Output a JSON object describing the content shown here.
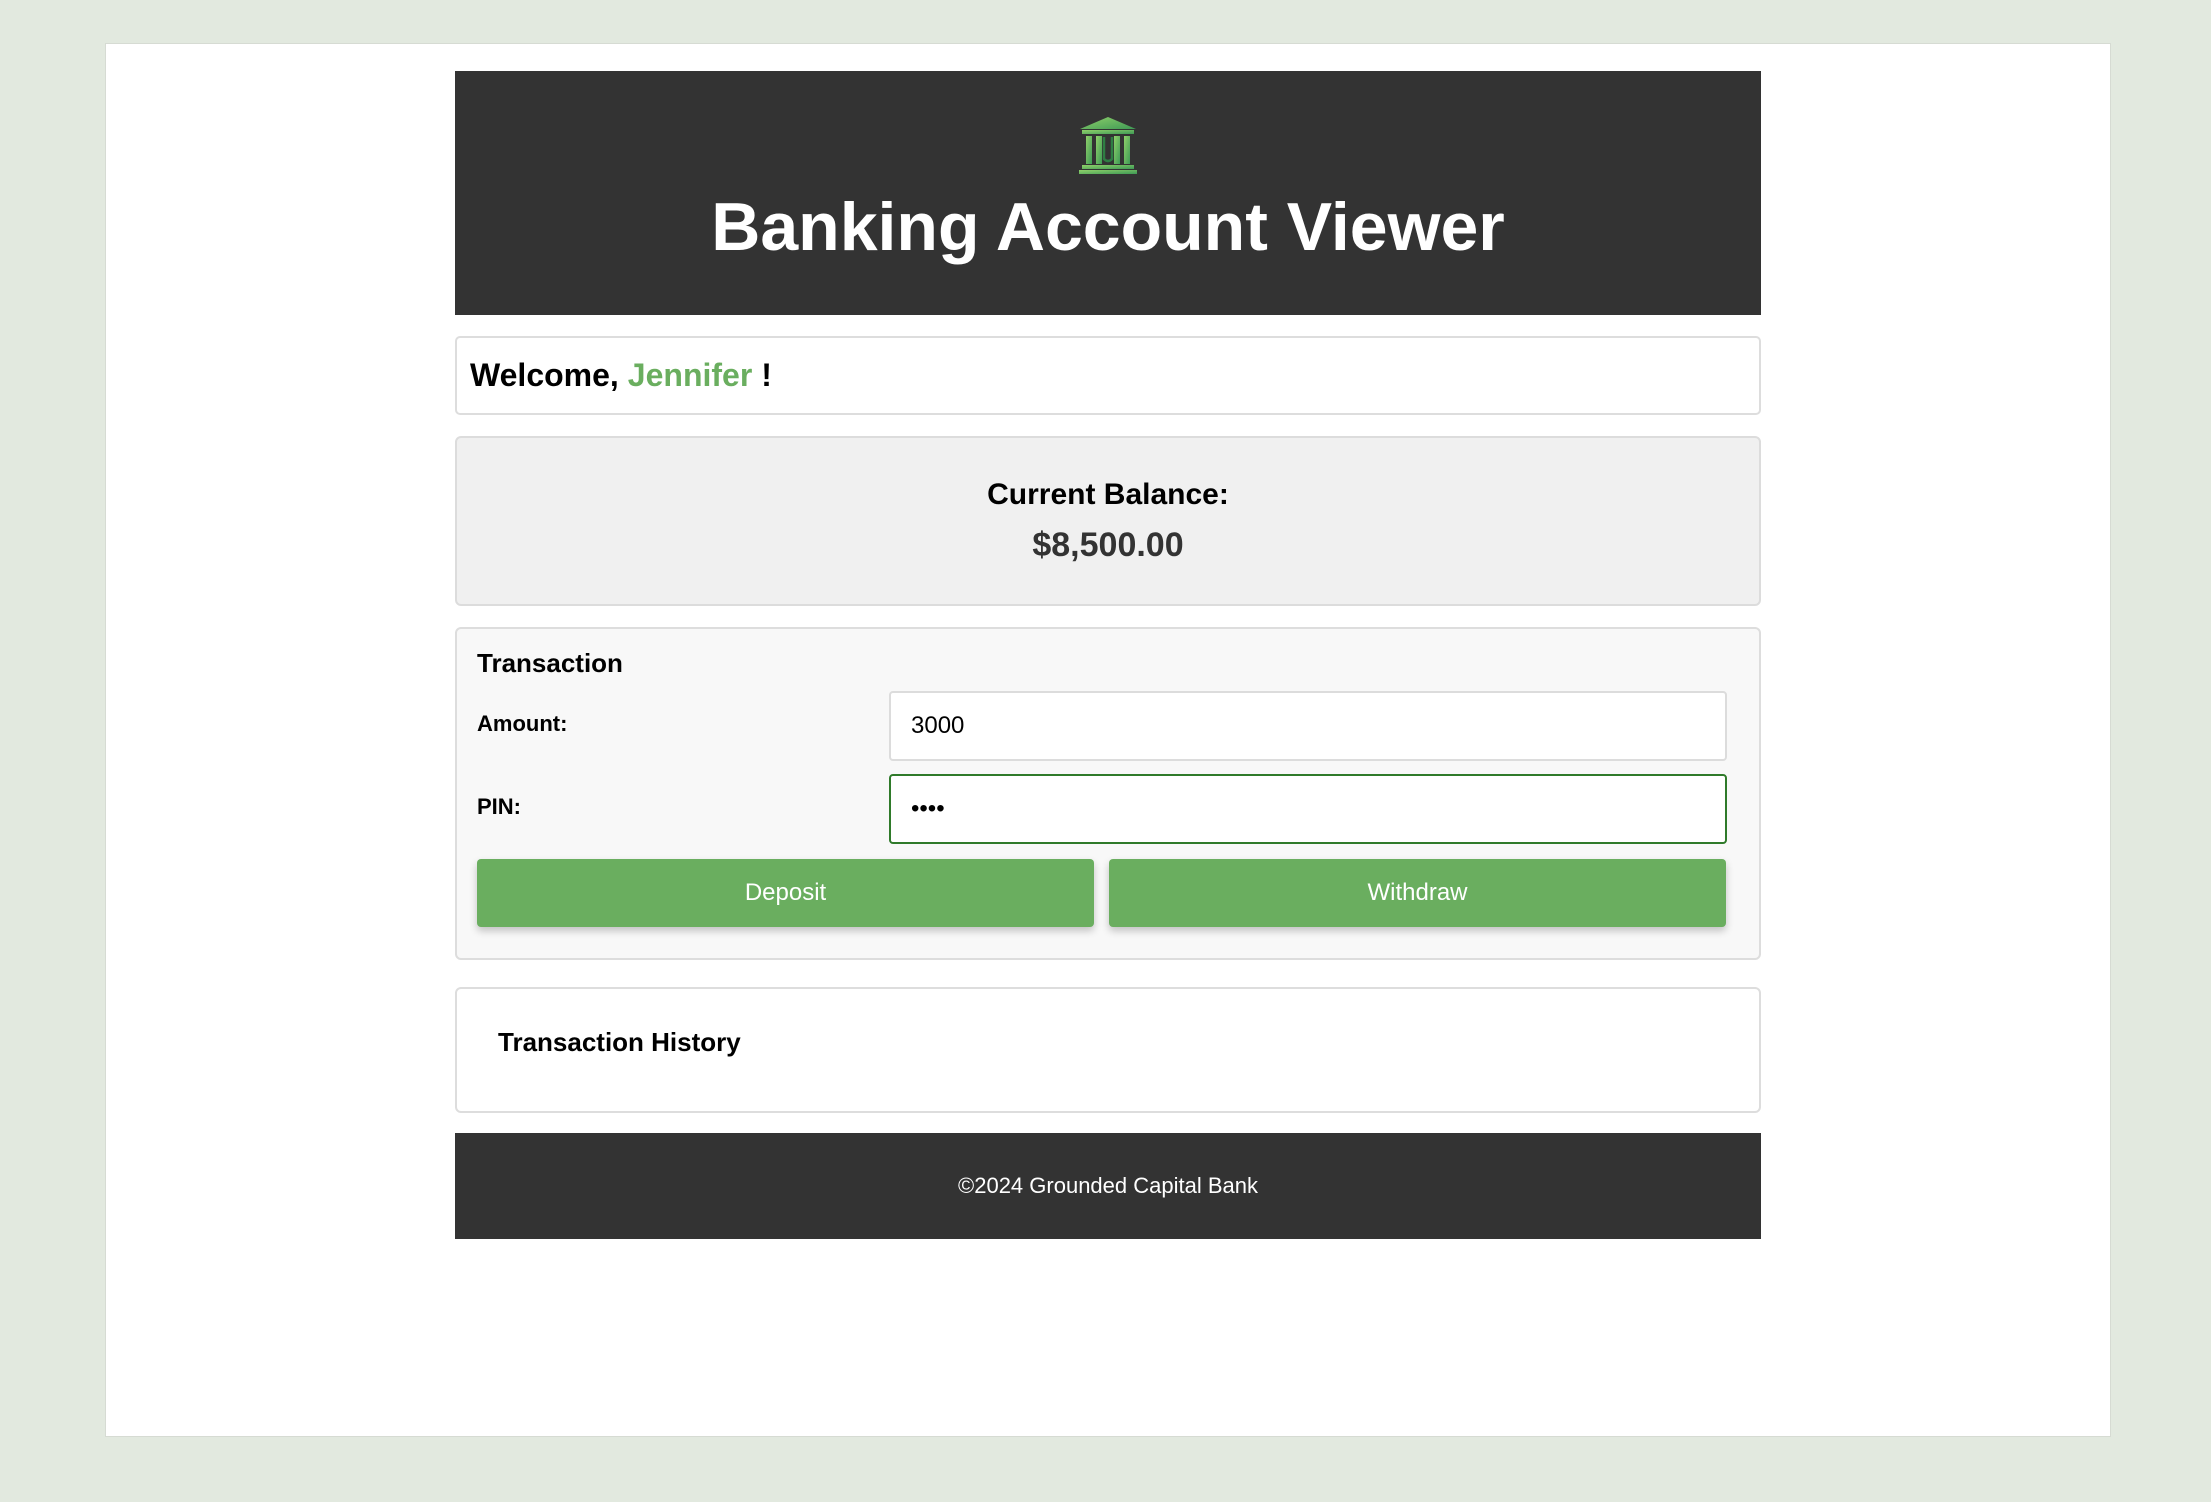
{
  "header": {
    "logo_icon": "bank-building-icon",
    "title": "Banking Account Viewer"
  },
  "welcome": {
    "prefix": "Welcome,",
    "username": "Jennifer",
    "suffix": "!"
  },
  "balance": {
    "label": "Current Balance:",
    "value": "$8,500.00"
  },
  "transaction": {
    "title": "Transaction",
    "amount_label": "Amount:",
    "amount_value": "3000",
    "pin_label": "PIN:",
    "pin_value": "1234",
    "deposit_label": "Deposit",
    "withdraw_label": "Withdraw"
  },
  "history": {
    "title": "Transaction History"
  },
  "footer": {
    "text": "©2024 Grounded Capital Bank"
  },
  "colors": {
    "accent": "#6aae5f",
    "header_bg": "#333333",
    "page_bg": "#e2e9df",
    "focus_border": "#2f7a2a"
  }
}
